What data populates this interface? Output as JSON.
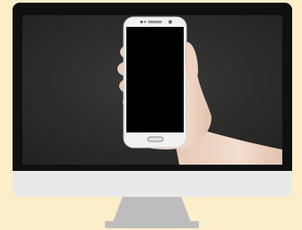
{
  "colors": {
    "page_background": "#fdeeca",
    "monitor_bezel": "#101010",
    "monitor_chin": "#e9e9e9",
    "monitor_stand": "#bdbdbd",
    "screen_background": "#2d2d2d",
    "phone_body": "#f1f1f1",
    "phone_screen": "#000000",
    "hand_skin": "#f0d8c8"
  },
  "icons": {
    "monitor": "desktop-monitor-icon",
    "phone": "smartphone-icon",
    "hand": "hand-holding-phone"
  }
}
